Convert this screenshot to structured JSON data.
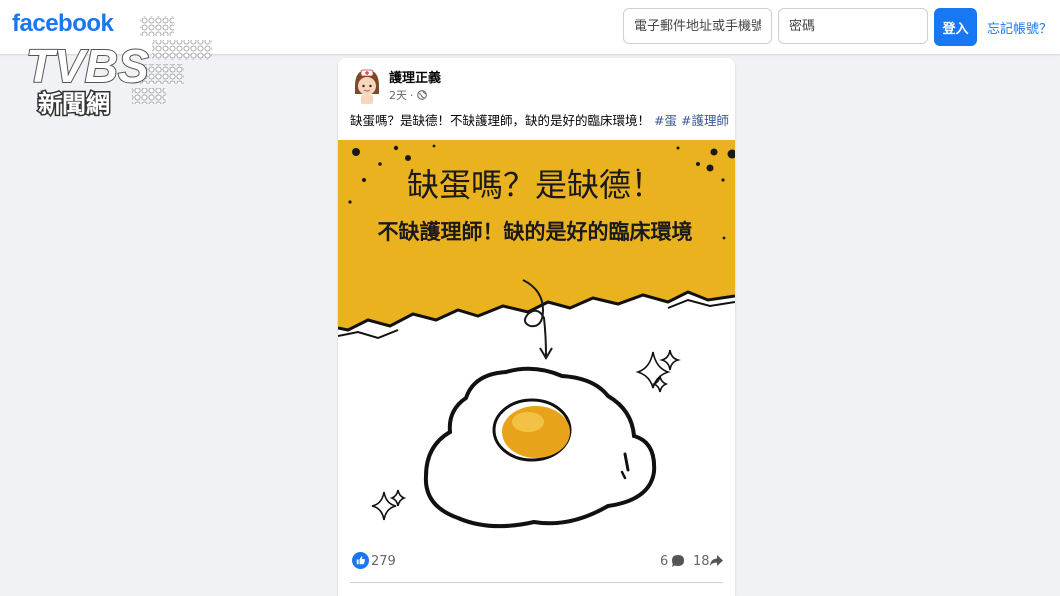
{
  "header": {
    "logo": "facebook",
    "email_placeholder": "電子郵件地址或手機號碼",
    "password_placeholder": "密碼",
    "login_label": "登入",
    "forgot_label": "忘記帳號？"
  },
  "watermark": {
    "brand": "TVBS",
    "subtitle": "新聞網"
  },
  "post": {
    "page_name": "護理正義",
    "time": "2天",
    "separator": "·",
    "privacy_icon": "globe-icon",
    "caption_text": "缺蛋嗎？是缺德！不缺護理師，缺的是好的臨床環境！",
    "hashtags": [
      "#蛋",
      "#護理師"
    ],
    "image": {
      "headline": "缺蛋嗎？是缺德！",
      "subheadline": "不缺護理師！缺的是好的臨床環境",
      "bg_color": "#eab21f"
    },
    "likes": "279",
    "comments": "6",
    "shares": "18"
  },
  "colors": {
    "brand": "#1877f2",
    "link": "#385898",
    "page_bg": "#f0f2f5"
  }
}
